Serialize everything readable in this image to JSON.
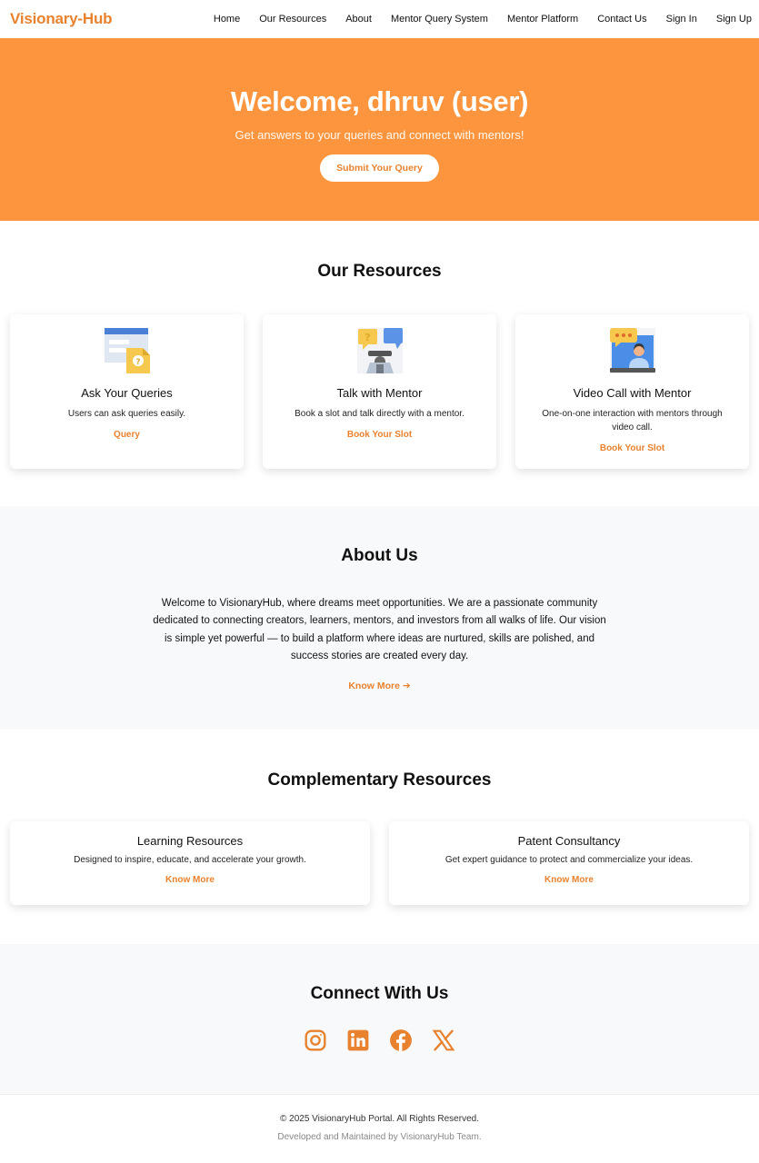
{
  "brand": "Visionary-Hub",
  "nav": [
    "Home",
    "Our Resources",
    "About",
    "Mentor Query System",
    "Mentor Platform",
    "Contact Us",
    "Sign In",
    "Sign Up"
  ],
  "hero": {
    "title": "Welcome, dhruv (user)",
    "subtitle": "Get answers to your queries and connect with mentors!",
    "button": "Submit Your Query"
  },
  "resources": {
    "title": "Our Resources",
    "cards": [
      {
        "icon": "query-document-icon",
        "title": "Ask Your Queries",
        "desc": "Users can ask queries easily.",
        "link": "Query"
      },
      {
        "icon": "mentor-chat-icon",
        "title": "Talk with Mentor",
        "desc": "Book a slot and talk directly with a mentor.",
        "link": "Book Your Slot"
      },
      {
        "icon": "video-call-icon",
        "title": "Video Call with Mentor",
        "desc": "One-on-one interaction with mentors through video call.",
        "link": "Book Your Slot"
      }
    ]
  },
  "about": {
    "title": "About Us",
    "text": "Welcome to VisionaryHub, where dreams meet opportunities. We are a passionate community dedicated to connecting creators, learners, mentors, and investors from all walks of life. Our vision is simple yet powerful — to build a platform where ideas are nurtured, skills are polished, and success stories are created every day.",
    "link": "Know More ➔"
  },
  "complementary": {
    "title": "Complementary Resources",
    "cards": [
      {
        "title": "Learning Resources",
        "desc": "Designed to inspire, educate, and accelerate your growth.",
        "link": "Know More"
      },
      {
        "title": "Patent Consultancy",
        "desc": "Get expert guidance to protect and commercialize your ideas.",
        "link": "Know More"
      }
    ]
  },
  "connect": {
    "title": "Connect With Us",
    "icons": [
      "instagram-icon",
      "linkedin-icon",
      "facebook-icon",
      "x-icon"
    ]
  },
  "footer": {
    "copyright": "© 2025 VisionaryHub Portal. All Rights Reserved.",
    "developed": "Developed and Maintained by VisionaryHub Team."
  },
  "colors": {
    "accent": "#e8822f",
    "hero_bg": "#fc953e",
    "section_bg": "#f8f9fb"
  }
}
